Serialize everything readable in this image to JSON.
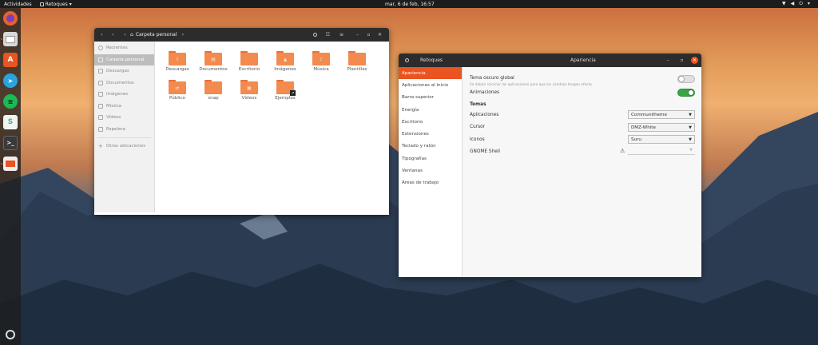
{
  "topbar": {
    "activities": "Actividades",
    "app_name": "Retoques",
    "clock": "mar, 6 de feb, 16:57"
  },
  "dock": {
    "items": [
      {
        "name": "firefox",
        "color": "#e8622b"
      },
      {
        "name": "files",
        "color": "#cfcfcf"
      },
      {
        "name": "software",
        "color": "#e95420"
      },
      {
        "name": "telegram",
        "color": "#2aa3de"
      },
      {
        "name": "spotify",
        "color": "#1db954"
      },
      {
        "name": "slack",
        "color": "#f4f4f4"
      },
      {
        "name": "terminal",
        "color": "#3a3a3a"
      },
      {
        "name": "tweaks",
        "color": "#eeeeee"
      }
    ]
  },
  "files_window": {
    "path_label": "Carpeta personal",
    "sidebar": [
      "Recientes",
      "Carpeta personal",
      "Descargas",
      "Documentos",
      "Imágenes",
      "Música",
      "Vídeos",
      "Papelera",
      "Otras ubicaciones"
    ],
    "folders": [
      "Descargas",
      "Documentos",
      "Escritorio",
      "Imágenes",
      "Música",
      "Plantillas",
      "Público",
      "snap",
      "Vídeos",
      "Ejemplos"
    ]
  },
  "tweaks_window": {
    "search_title": "Retoques",
    "section_title": "Apariencia",
    "sidebar": [
      "Apariencia",
      "Aplicaciones al inicio",
      "Barra superior",
      "Energía",
      "Escritorio",
      "Extensiones",
      "Teclado y ratón",
      "Tipografías",
      "Ventanas",
      "Áreas de trabajo"
    ],
    "dark_theme_label": "Tema oscuro global",
    "dark_theme_note": "Se deben reiniciar las aplicaciones para que los cambios tengan efecto.",
    "dark_theme_on": false,
    "animations_label": "Animaciones",
    "animations_on": true,
    "themes_header": "Temas",
    "applications_label": "Aplicaciones",
    "applications_value": "Communitheme",
    "cursor_label": "Cursor",
    "cursor_value": "DMZ-White",
    "icons_label": "Iconos",
    "icons_value": "Suru",
    "shell_label": "GNOME Shell",
    "shell_value": ""
  },
  "colors": {
    "accent": "#e95420",
    "toggle_on": "#3aa544"
  }
}
